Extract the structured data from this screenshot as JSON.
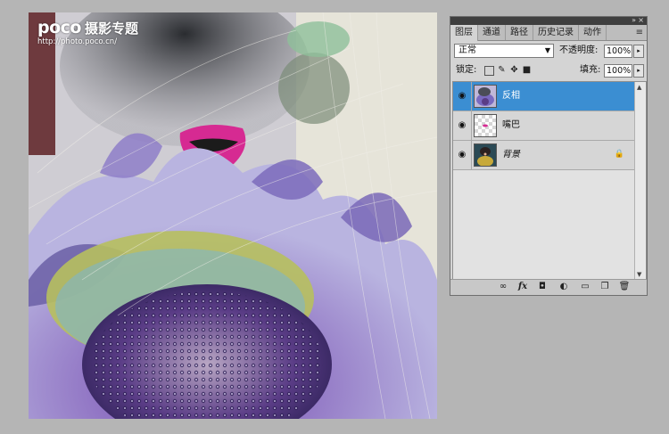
{
  "watermark": {
    "brand": "poco",
    "brand_sub": "摄影专题",
    "url": "http://photo.poco.cn/"
  },
  "panel": {
    "collapse_icon": "»",
    "close_icon": "×",
    "menu_icon": "≡",
    "tabs": [
      {
        "label": "图层",
        "active": true
      },
      {
        "label": "通道",
        "active": false
      },
      {
        "label": "路径",
        "active": false
      },
      {
        "label": "历史记录",
        "active": false
      },
      {
        "label": "动作",
        "active": false
      }
    ],
    "blend_mode": "正常",
    "opacity_label": "不透明度:",
    "opacity_value": "100%",
    "lock_label": "锁定:",
    "fill_label": "填充:",
    "fill_value": "100%",
    "layers": [
      {
        "name": "反相",
        "selected": true,
        "italic": false,
        "locked": false
      },
      {
        "name": "嘴巴",
        "selected": false,
        "italic": false,
        "locked": false
      },
      {
        "name": "背景",
        "selected": false,
        "italic": true,
        "locked": true
      }
    ],
    "bottom_icons": [
      "link-icon",
      "fx-icon",
      "mask-icon",
      "adjustment-icon",
      "group-icon",
      "new-layer-icon",
      "trash-icon"
    ],
    "fx_label": "fx"
  },
  "colors": {
    "selection": "#3b8ed2",
    "panel_bg": "#d4d4d4",
    "app_bg": "#b5b5b5"
  }
}
